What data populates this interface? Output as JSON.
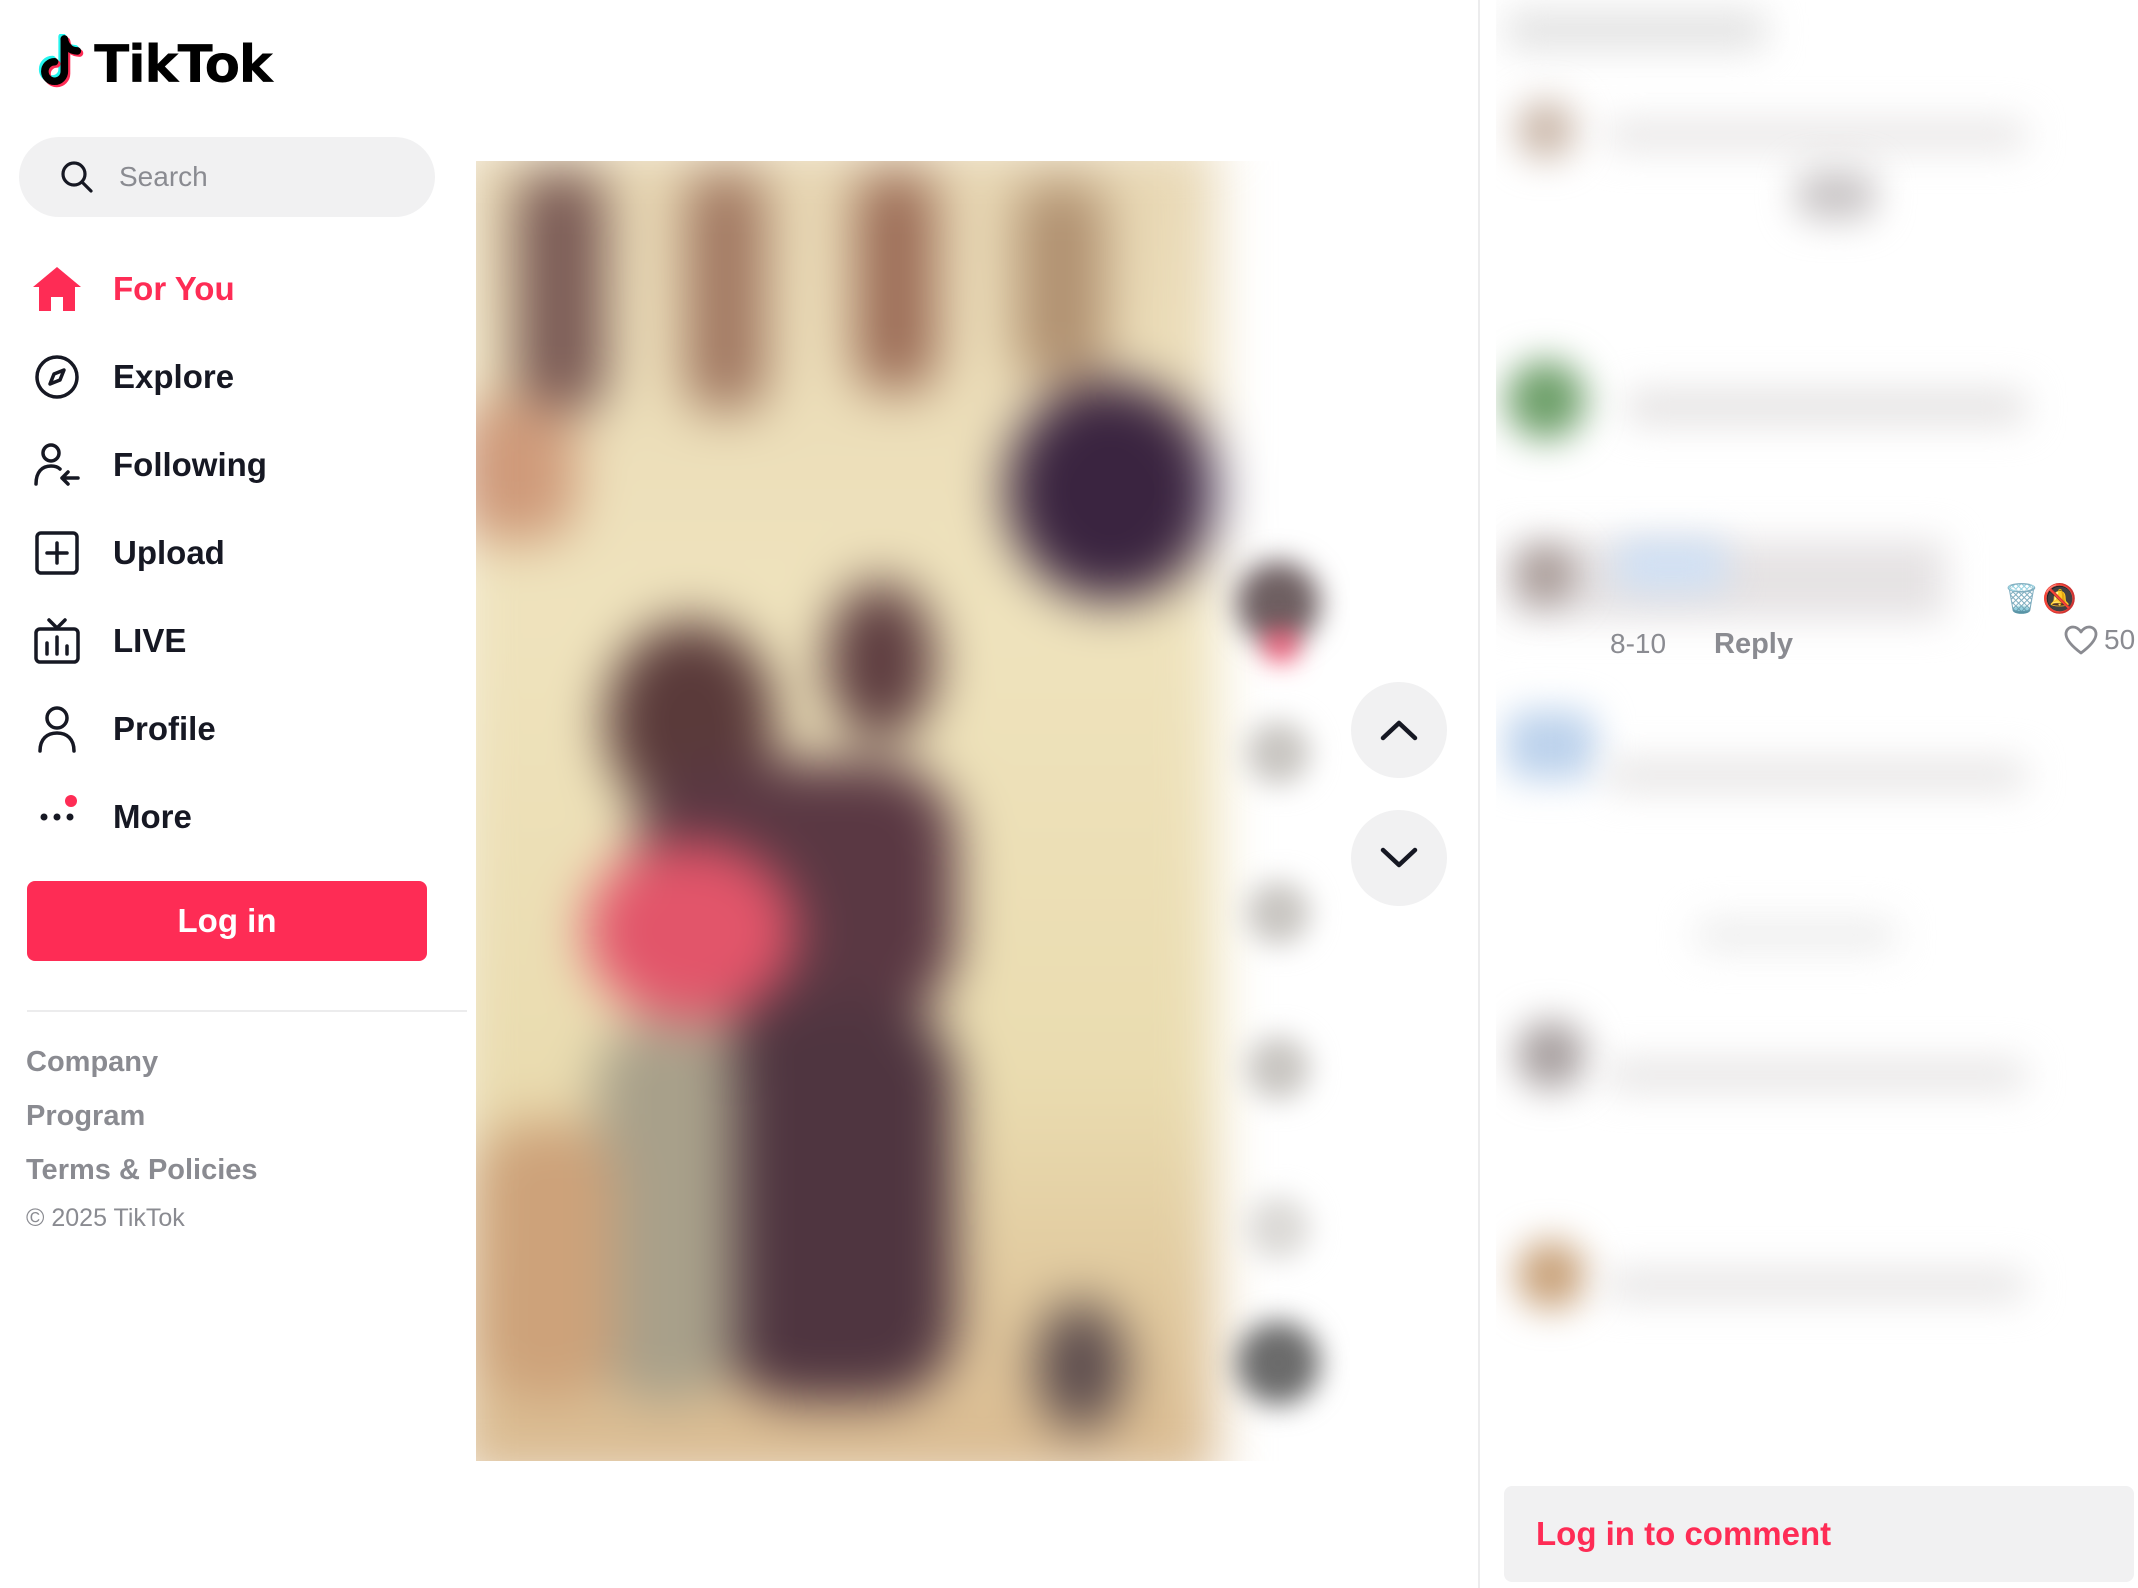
{
  "brand": {
    "name": "TikTok"
  },
  "search": {
    "placeholder": "Search"
  },
  "nav": {
    "items": [
      {
        "label": "For You",
        "icon": "home-icon",
        "active": true
      },
      {
        "label": "Explore",
        "icon": "compass-icon"
      },
      {
        "label": "Following",
        "icon": "following-icon"
      },
      {
        "label": "Upload",
        "icon": "upload-icon"
      },
      {
        "label": "LIVE",
        "icon": "live-tv-icon"
      },
      {
        "label": "Profile",
        "icon": "profile-icon"
      },
      {
        "label": "More",
        "icon": "more-dots-icon"
      }
    ]
  },
  "auth": {
    "login_label": "Log in"
  },
  "footer": {
    "links": [
      "Company",
      "Program",
      "Terms & Policies"
    ],
    "copyright": "© 2025 TikTok"
  },
  "comments": {
    "visible_comment": {
      "date": "8-10",
      "reply_label": "Reply",
      "like_count": "50",
      "emojis": [
        "🗑️",
        "🔕"
      ]
    },
    "login_prompt": "Log in to comment"
  },
  "colors": {
    "accent": "#fe2c55",
    "text_primary": "#161823",
    "text_secondary": "#8a8b91",
    "surface": "#f1f1f2"
  }
}
